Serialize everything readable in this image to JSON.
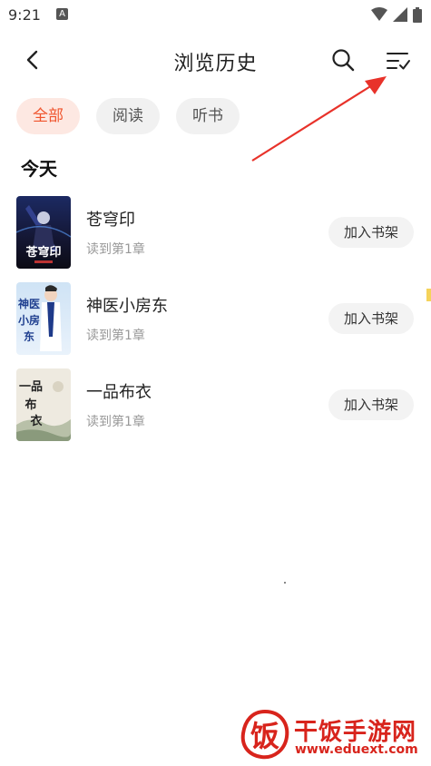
{
  "status_bar": {
    "time": "9:21",
    "notification_letter": "A",
    "icons": [
      "wifi-icon",
      "signal-icon",
      "battery-icon"
    ]
  },
  "app_bar": {
    "title": "浏览历史",
    "icons": [
      "back-arrow-icon",
      "search-icon",
      "manage-list-icon"
    ]
  },
  "filters": [
    {
      "label": "全部",
      "active": true
    },
    {
      "label": "阅读",
      "active": false
    },
    {
      "label": "听书",
      "active": false
    }
  ],
  "section": {
    "heading": "今天"
  },
  "books": [
    {
      "title": "苍穹印",
      "progress": "读到第1章",
      "action": "加入书架",
      "cover_text": "苍穹印"
    },
    {
      "title": "神医小房东",
      "progress": "读到第1章",
      "action": "加入书架",
      "cover_text": "神医小房东"
    },
    {
      "title": "一品布衣",
      "progress": "读到第1章",
      "action": "加入书架",
      "cover_text": "一品布衣"
    }
  ],
  "watermark": {
    "logo_char": "饭",
    "name": "干饭手游网",
    "url": "www.eduext.com"
  },
  "colors": {
    "accent": "#f0542d",
    "chip_active_bg": "#fde8e2",
    "chip_bg": "#f1f1f1",
    "arrow": "#e8322a",
    "watermark": "#d8241c"
  }
}
